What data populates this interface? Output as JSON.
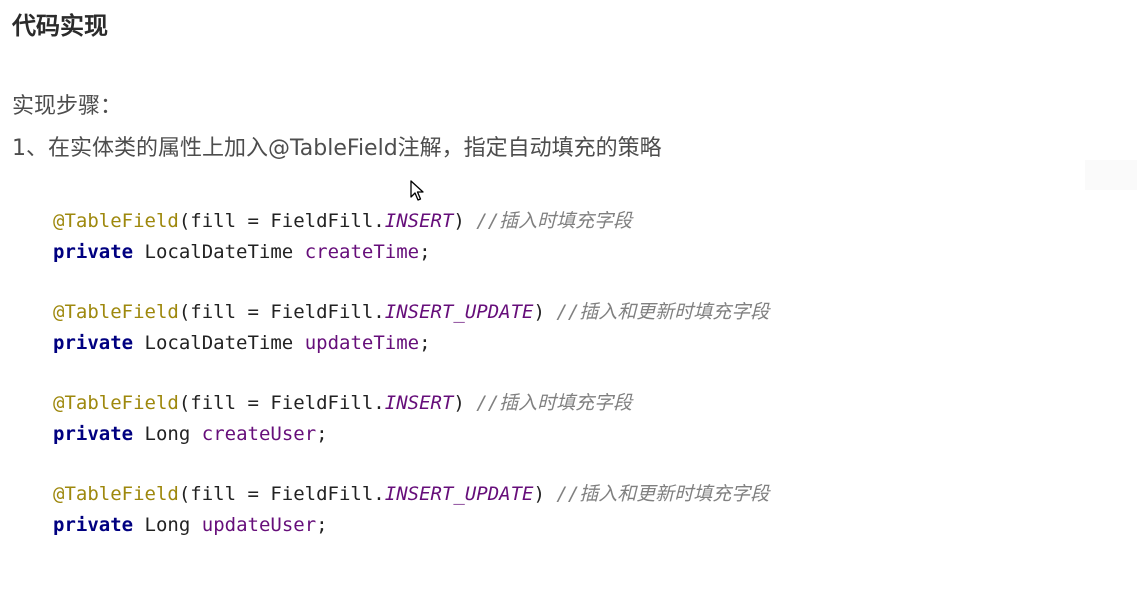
{
  "heading": "代码实现",
  "steps_label": "实现步骤：",
  "step1": "1、在实体类的属性上加入@TableField注解，指定自动填充的策略",
  "code": [
    {
      "annotation": "@TableField",
      "args_prefix": "(fill = FieldFill.",
      "constant": "INSERT",
      "args_suffix": ")",
      "comment": "//插入时填充字段",
      "modifier": "private",
      "type": "LocalDateTime",
      "field": "createTime",
      "end": ";"
    },
    {
      "annotation": "@TableField",
      "args_prefix": "(fill = FieldFill.",
      "constant": "INSERT_UPDATE",
      "args_suffix": ")",
      "comment": "//插入和更新时填充字段",
      "modifier": "private",
      "type": "LocalDateTime",
      "field": "updateTime",
      "end": ";"
    },
    {
      "annotation": "@TableField",
      "args_prefix": "(fill = FieldFill.",
      "constant": "INSERT",
      "args_suffix": ")",
      "comment": "//插入时填充字段",
      "modifier": "private",
      "type": "Long",
      "field": "createUser",
      "end": ";"
    },
    {
      "annotation": "@TableField",
      "args_prefix": "(fill = FieldFill.",
      "constant": "INSERT_UPDATE",
      "args_suffix": ")",
      "comment": "//插入和更新时填充字段",
      "modifier": "private",
      "type": "Long",
      "field": "updateUser",
      "end": ";"
    }
  ],
  "colors": {
    "annotation": "#9e880d",
    "keyword": "#000080",
    "field": "#660e7a",
    "comment": "#808080"
  },
  "icons": {
    "cursor": "mouse-pointer-icon"
  }
}
